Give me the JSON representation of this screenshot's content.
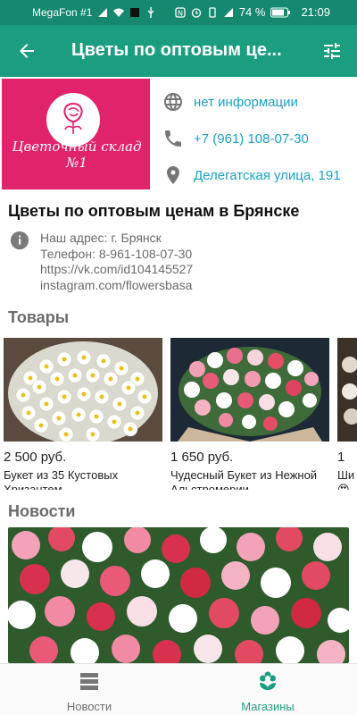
{
  "status_bar": {
    "carrier": "MegaFon #1",
    "battery": "74 %",
    "time": "21:09"
  },
  "app_bar": {
    "title": "Цветы по оптовым це..."
  },
  "header": {
    "logo_text": "Цветочный склад №1",
    "website": "нет информации",
    "phone": "+7 (961) 108-07-30",
    "address": "Делегатская улица, 191"
  },
  "shop": {
    "title": "Цветы по оптовым ценам в Брянске",
    "about_lines": [
      "Наш адрес: г. Брянск",
      "Телефон: 8-961-108-07-30",
      "https://vk.com/id104145527",
      "instagram.com/flowersbasa"
    ]
  },
  "sections": {
    "products": "Товары",
    "news": "Новости"
  },
  "products": [
    {
      "price": "2 500 руб.",
      "name_line1": "Букет из 35 Кустовых",
      "name_line2": "Хризантем"
    },
    {
      "price": "1 650 руб.",
      "name_line1": "Чудесный Букет из Нежной",
      "name_line2": "Альстромерии"
    },
    {
      "price": "1",
      "name_line1": "Ши",
      "name_line2": "😍"
    }
  ],
  "bottom_nav": {
    "news": "Новости",
    "shops": "Магазины"
  },
  "colors": {
    "primary": "#1b9d7f",
    "status_bar": "#16886f",
    "link": "#1a9fc6",
    "logo_bg": "#e0236b"
  },
  "icons": {
    "website": "globe-icon",
    "phone": "phone-icon",
    "address": "map-pin-icon",
    "about": "info-icon"
  }
}
